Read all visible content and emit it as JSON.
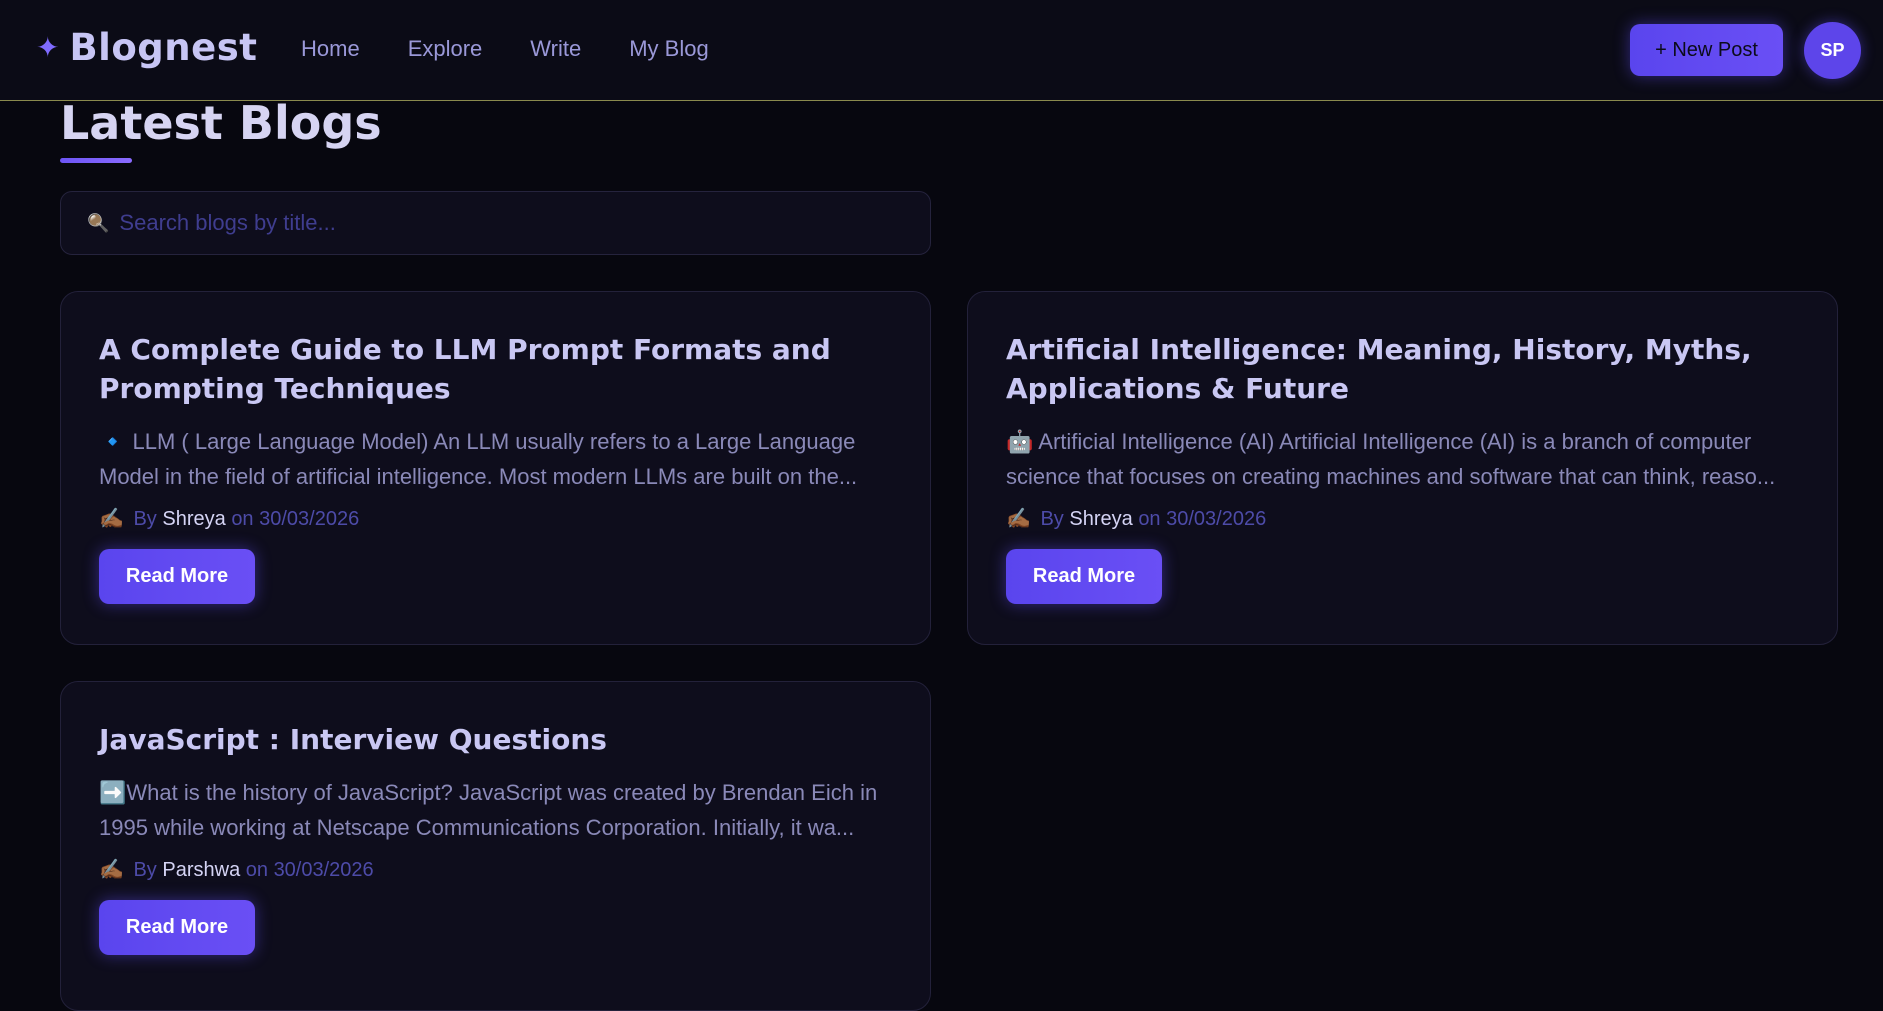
{
  "brand": {
    "icon": "sparkle-icon",
    "glyph": "✦",
    "name": "Blognest"
  },
  "nav": {
    "items": [
      "Home",
      "Explore",
      "Write",
      "My Blog"
    ]
  },
  "header": {
    "new_post_label": "+ New Post",
    "avatar_initials": "SP"
  },
  "main": {
    "title": "Latest Blogs",
    "search": {
      "placeholder": "Search blogs by title...",
      "icon": "search-icon",
      "glyph": "🔍"
    }
  },
  "posts": [
    {
      "title": "A Complete Guide to LLM Prompt Formats and Prompting Techniques",
      "excerpt": "🔹 LLM ( Large Language Model) An LLM usually refers to a Large Language Model in the field of artificial intelligence. Most modern LLMs are built on the...",
      "by_label": "By",
      "author": "Shreya",
      "on_label": "on",
      "date": "30/03/2026",
      "read_more": "Read More"
    },
    {
      "title": "Artificial Intelligence: Meaning, History, Myths, Applications & Future",
      "excerpt": "🤖 Artificial Intelligence (AI) Artificial Intelligence (AI) is a branch of computer science that focuses on creating machines and software that can think, reaso...",
      "by_label": "By",
      "author": "Shreya",
      "on_label": "on",
      "date": "30/03/2026",
      "read_more": "Read More"
    },
    {
      "title": "JavaScript : Interview Questions",
      "excerpt": "➡️What is the history of JavaScript? JavaScript was created by Brendan Eich in 1995 while working at Netscape Communications Corporation. Initially, it wa...",
      "by_label": "By",
      "author": "Parshwa",
      "on_label": "on",
      "date": "30/03/2026",
      "read_more": "Read More"
    }
  ],
  "meta_icon": {
    "name": "writing-hand-icon",
    "glyph": "✍🏾"
  },
  "colors": {
    "accent": "#5a45ee",
    "background": "#07070f",
    "card": "#0e0d1c"
  }
}
